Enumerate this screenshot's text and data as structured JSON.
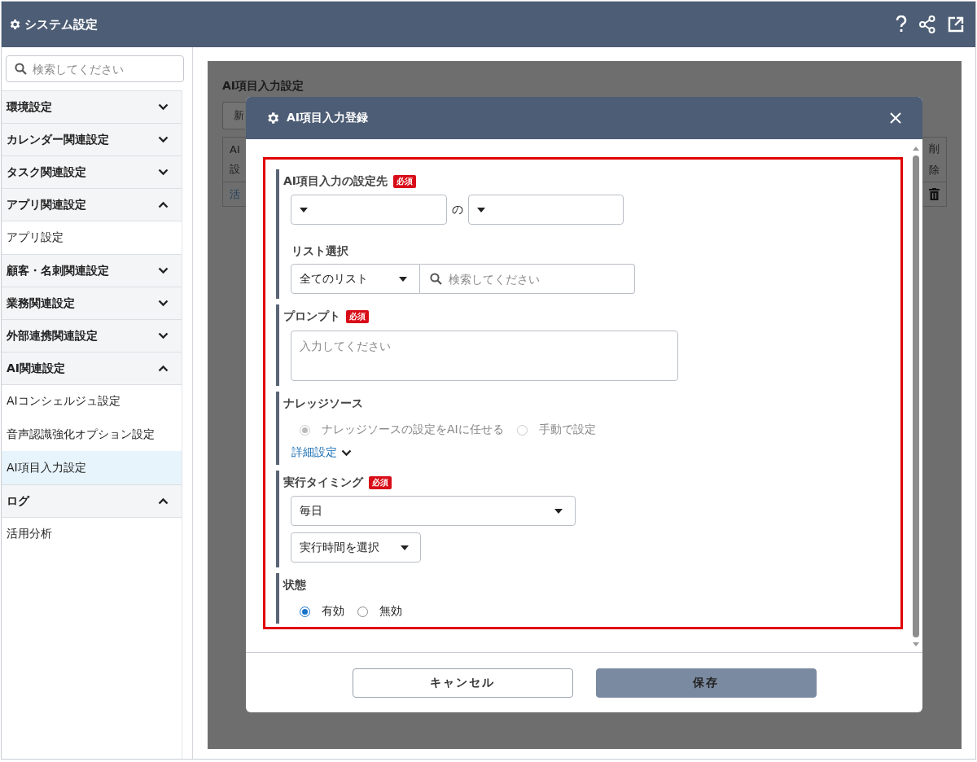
{
  "header": {
    "title": "システム設定"
  },
  "sidebar": {
    "search_placeholder": "検索してください",
    "groups": [
      {
        "label": "環境設定",
        "expanded": false
      },
      {
        "label": "カレンダー関連設定",
        "expanded": false
      },
      {
        "label": "タスク関連設定",
        "expanded": false
      },
      {
        "label": "アプリ関連設定",
        "expanded": true,
        "children": [
          {
            "label": "アプリ設定",
            "selected": false
          }
        ]
      },
      {
        "label": "顧客・名刺関連設定",
        "expanded": false
      },
      {
        "label": "業務関連設定",
        "expanded": false
      },
      {
        "label": "外部連携関連設定",
        "expanded": false
      },
      {
        "label": "AI関連設定",
        "expanded": true,
        "children": [
          {
            "label": "AIコンシェルジュ設定",
            "selected": false
          },
          {
            "label": "音声認識強化オプション設定",
            "selected": false
          },
          {
            "label": "AI項目入力設定",
            "selected": true
          }
        ]
      },
      {
        "label": "ログ",
        "expanded": true,
        "children": [
          {
            "label": "活用分析",
            "selected": false
          }
        ]
      }
    ]
  },
  "background": {
    "title": "AI項目入力設定",
    "new_button": "新",
    "table": {
      "header_left": [
        "AI",
        "設"
      ],
      "header_right": [
        "削",
        "除"
      ],
      "row_link": "活"
    }
  },
  "modal": {
    "title": "AI項目入力登録",
    "sections": [
      {
        "kind": "target",
        "label": "AI項目入力の設定先",
        "badge": "必須",
        "connector": "の",
        "list_label": "リスト選択",
        "list_select": "全てのリスト",
        "search_placeholder": "検索してください"
      },
      {
        "kind": "textarea",
        "label": "プロンプト",
        "badge": "必須",
        "placeholder": "入力してください"
      },
      {
        "kind": "radio",
        "label": "ナレッジソース",
        "disabled": true,
        "options": [
          {
            "label": "ナレッジソースの設定をAIに任せる",
            "selected": true
          },
          {
            "label": "手動で設定",
            "selected": false
          }
        ],
        "link": "詳細設定"
      },
      {
        "kind": "timing",
        "label": "実行タイミング",
        "badge": "必須",
        "select": "毎日",
        "time_select": "実行時間を選択"
      },
      {
        "kind": "radio",
        "label": "状態",
        "disabled": false,
        "options": [
          {
            "label": "有効",
            "selected": true
          },
          {
            "label": "無効",
            "selected": false
          }
        ]
      }
    ],
    "buttons": [
      {
        "label": "キャンセル",
        "kind": "secondary"
      },
      {
        "label": "保存",
        "kind": "primary"
      }
    ]
  }
}
